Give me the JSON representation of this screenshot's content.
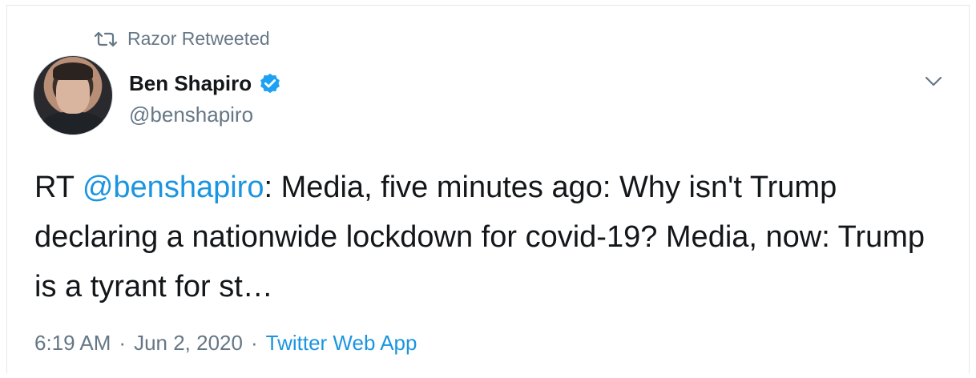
{
  "retweet": {
    "label": "Razor Retweeted",
    "icon": "retweet-icon"
  },
  "author": {
    "display_name": "Ben Shapiro",
    "handle": "@benshapiro",
    "verified_icon": "verified-badge-icon"
  },
  "tweet": {
    "prefix": "RT ",
    "mention": "@benshapiro",
    "body": ": Media, five minutes ago: Why isn't Trump declaring a nationwide lockdown for covid-19? Media, now: Trump is a tyrant for st…"
  },
  "meta": {
    "time": "6:19 AM",
    "separator": "·",
    "date": "Jun 2, 2020",
    "source": "Twitter Web App"
  },
  "colors": {
    "link": "#1b95e0",
    "secondary_text": "#657786",
    "primary_text": "#14171a",
    "border": "#e1e8ed"
  }
}
